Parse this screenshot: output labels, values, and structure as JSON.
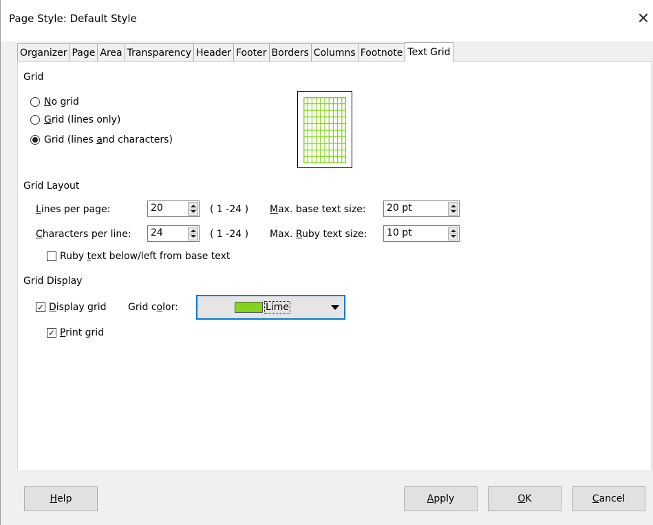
{
  "window": {
    "title": "Page Style: Default Style",
    "close_glyph": "✕"
  },
  "tabs": [
    {
      "label": "Organizer"
    },
    {
      "label": "Page"
    },
    {
      "label": "Area"
    },
    {
      "label": "Transparency"
    },
    {
      "label": "Header"
    },
    {
      "label": "Footer"
    },
    {
      "label": "Borders"
    },
    {
      "label": "Columns"
    },
    {
      "label": "Footnote"
    },
    {
      "label": "Text Grid",
      "active": true
    }
  ],
  "grid": {
    "title": "Grid",
    "options": [
      {
        "pre": "",
        "key": "N",
        "post": "o grid",
        "checked": false
      },
      {
        "pre": "",
        "key": "G",
        "post": "rid (lines only)",
        "checked": false
      },
      {
        "pre": "Grid (lines ",
        "key": "a",
        "post": "nd characters)",
        "checked": true
      }
    ],
    "preview_color": "#81d41a"
  },
  "layout": {
    "title": "Grid Layout",
    "lines_per_page": {
      "pre": "",
      "key": "L",
      "post": "ines per page:",
      "value": "20",
      "range": "( 1 -24 )"
    },
    "chars_per_line": {
      "pre": "",
      "key": "C",
      "post": "haracters per line:",
      "value": "24",
      "range": "( 1 -24 )"
    },
    "max_base": {
      "pre": "",
      "key": "M",
      "post": "ax. base text size:",
      "value": "20 pt"
    },
    "max_ruby": {
      "pre": "Max. ",
      "key": "R",
      "post": "uby text size:",
      "value": "10 pt"
    },
    "ruby_below": {
      "pre": "Ruby ",
      "key": "t",
      "post": "ext below/left from base text",
      "checked": false
    }
  },
  "display": {
    "title": "Grid Display",
    "display_grid": {
      "pre": "",
      "key": "D",
      "post": "isplay grid",
      "checked": true
    },
    "grid_color_label": {
      "pre": "Grid c",
      "key": "o",
      "post": "lor:"
    },
    "grid_color_value": "Lime",
    "grid_color_hex": "#81d41a",
    "print_grid": {
      "pre": "",
      "key": "P",
      "post": "rint grid",
      "checked": true
    }
  },
  "buttons": {
    "help": {
      "pre": "",
      "key": "H",
      "post": "elp"
    },
    "apply": {
      "pre": "",
      "key": "A",
      "post": "pply"
    },
    "ok": {
      "pre": "",
      "key": "O",
      "post": "K"
    },
    "cancel": {
      "pre": "",
      "key": "C",
      "post": "ancel"
    }
  },
  "icons": {
    "checkmark": "✓"
  }
}
